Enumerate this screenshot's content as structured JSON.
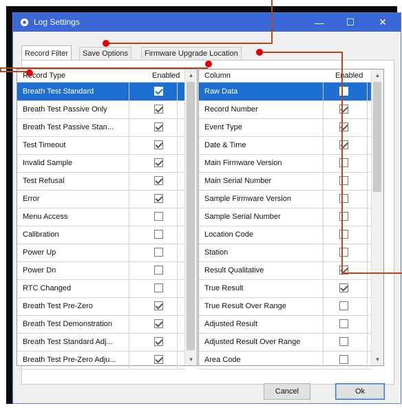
{
  "window": {
    "title": "Log Settings",
    "minimize_glyph": "—",
    "maximize_glyph": "☐",
    "close_glyph": "✕",
    "titlebar_color": "#3a67d6"
  },
  "tabs": [
    {
      "label": "Record Filter",
      "active": true
    },
    {
      "label": "Save Options",
      "active": false
    },
    {
      "label": "Firmware Upgrade Location",
      "active": false
    }
  ],
  "record_types": {
    "headers": {
      "name": "Record Type",
      "enabled": "Enabled"
    },
    "rows": [
      {
        "name": "Breath Test Standard",
        "enabled": true,
        "selected": true
      },
      {
        "name": "Breath Test Passive Only",
        "enabled": true
      },
      {
        "name": "Breath Test Passive Stan...",
        "enabled": true
      },
      {
        "name": "Test Timeout",
        "enabled": true
      },
      {
        "name": "Invalid Sample",
        "enabled": true
      },
      {
        "name": "Test Refusal",
        "enabled": true
      },
      {
        "name": "Error",
        "enabled": true
      },
      {
        "name": "Menu Access",
        "enabled": false
      },
      {
        "name": "Calibration",
        "enabled": false
      },
      {
        "name": "Power Up",
        "enabled": false
      },
      {
        "name": "Power Dn",
        "enabled": false
      },
      {
        "name": "RTC Changed",
        "enabled": false
      },
      {
        "name": "Breath Test Pre-Zero",
        "enabled": true
      },
      {
        "name": "Breath Test Demonstration",
        "enabled": true
      },
      {
        "name": "Breath Test Standard Adj...",
        "enabled": true
      },
      {
        "name": "Breath Test Pre-Zero Adju...",
        "enabled": true
      }
    ]
  },
  "columns": {
    "headers": {
      "name": "Column",
      "enabled": "Enabled"
    },
    "rows": [
      {
        "name": "Raw Data",
        "enabled": false,
        "selected": true
      },
      {
        "name": "Record Number",
        "enabled": true
      },
      {
        "name": "Event Type",
        "enabled": true
      },
      {
        "name": "Date & Time",
        "enabled": true
      },
      {
        "name": "Main Firmware Version",
        "enabled": false
      },
      {
        "name": "Main Serial Number",
        "enabled": false
      },
      {
        "name": "Sample Firmware Version",
        "enabled": false
      },
      {
        "name": "Sample Serial Number",
        "enabled": false
      },
      {
        "name": "Location Code",
        "enabled": false
      },
      {
        "name": "Station",
        "enabled": false
      },
      {
        "name": "Result Qualitative",
        "enabled": true
      },
      {
        "name": "True Result",
        "enabled": true
      },
      {
        "name": "True Result Over Range",
        "enabled": false
      },
      {
        "name": "Adjusted Result",
        "enabled": false
      },
      {
        "name": "Adjusted Result Over Range",
        "enabled": false
      },
      {
        "name": "Area Code",
        "enabled": false
      }
    ]
  },
  "buttons": {
    "cancel": "Cancel",
    "ok": "Ok"
  },
  "icons": {
    "window_icon": "gear-icon",
    "scroll_up": "chevron-up-icon",
    "scroll_down": "chevron-down-icon"
  },
  "scroll": {
    "up_glyph": "▲",
    "down_glyph": "▼",
    "left_list_position": 0.0,
    "right_list_position": 0.0
  },
  "colors": {
    "selection": "#1e6fd2",
    "callout": "#e00000"
  }
}
